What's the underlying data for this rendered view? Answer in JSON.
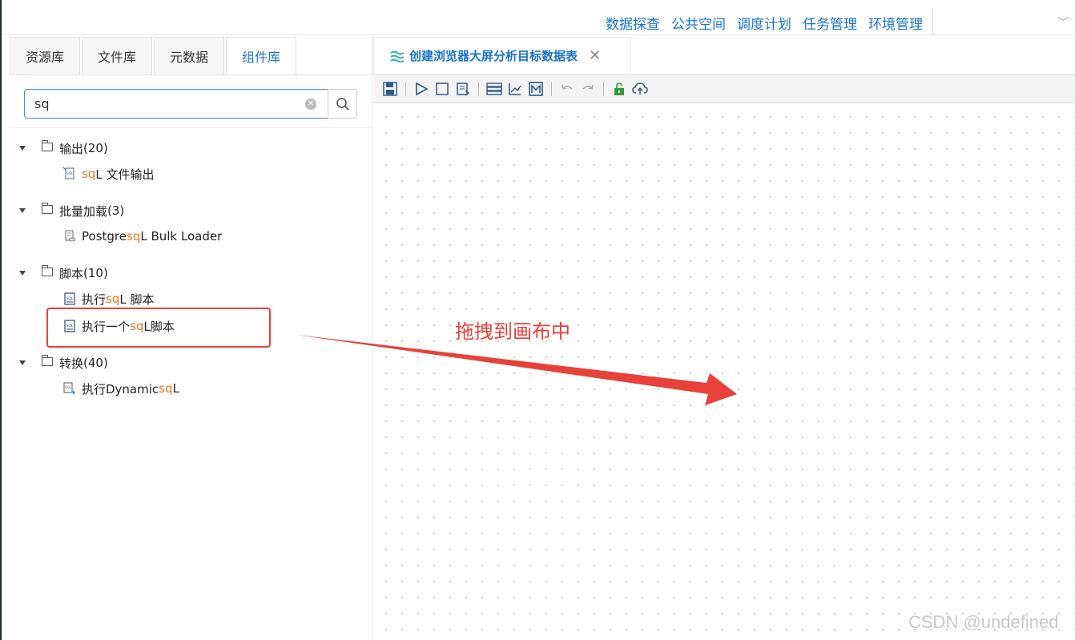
{
  "topnav": {
    "links": [
      "数据探查",
      "公共空间",
      "调度计划",
      "任务管理",
      "环境管理"
    ]
  },
  "left": {
    "tabs": [
      "资源库",
      "文件库",
      "元数据",
      "组件库"
    ],
    "active_tab": "组件库",
    "search": {
      "value": "sq"
    },
    "groups": [
      {
        "label": "输出",
        "count": "(20)",
        "items": [
          {
            "pre": "",
            "hl": "sq",
            "post": " L 文件输出",
            "icon": "sql-file-output-icon"
          }
        ]
      },
      {
        "label": "批量加载",
        "count": "(3)",
        "items": [
          {
            "pre": "Postgre ",
            "hl": "sq",
            "post": " L Bulk Loader",
            "icon": "database-loader-icon"
          }
        ]
      },
      {
        "label": "脚本",
        "count": "(10)",
        "items": [
          {
            "pre": "执行 ",
            "hl": "sq",
            "post": " L 脚本",
            "icon": "sql-script-icon"
          },
          {
            "pre": "执行一个 ",
            "hl": "sq",
            "post": " L脚本",
            "icon": "sql-script-icon"
          }
        ]
      },
      {
        "label": "转换",
        "count": "(40)",
        "items": [
          {
            "pre": "执行Dynamic ",
            "hl": "sq",
            "post": " L",
            "icon": "dynamic-sql-icon"
          }
        ]
      }
    ]
  },
  "right": {
    "file_tab": {
      "label": "创建浏览器大屏分析目标数据表",
      "icon": "workflow-waves-icon"
    },
    "toolbar": [
      "save-icon",
      "run-icon",
      "stop-icon",
      "preview-icon",
      "layout-icon",
      "chart-icon",
      "m-icon",
      "undo-icon",
      "redo-icon",
      "unlock-icon",
      "upload-icon"
    ]
  },
  "annotation": {
    "text": "拖拽到画布中"
  },
  "watermark": "CSDN @undefined",
  "colors": {
    "accent": "#1a73c8",
    "highlight": "#e87620",
    "annotation": "#e8413a"
  }
}
